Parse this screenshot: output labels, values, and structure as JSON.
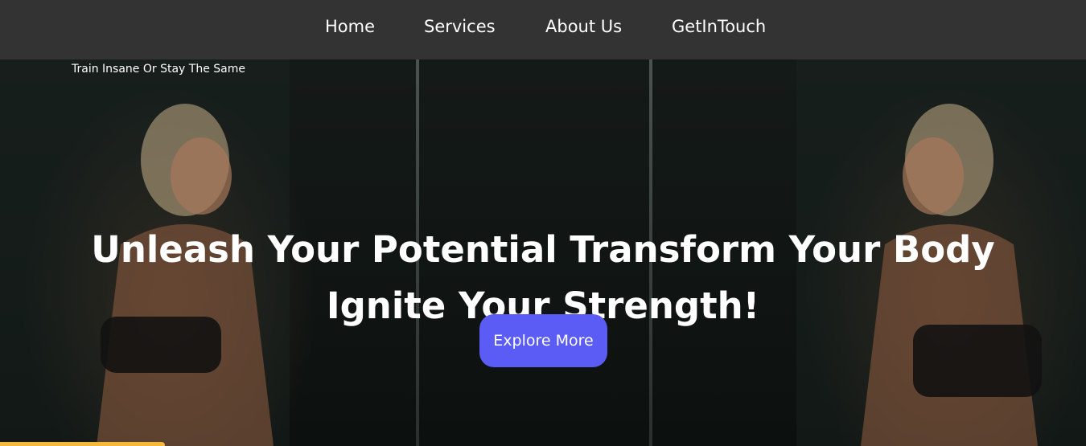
{
  "nav": {
    "items": [
      {
        "label": "Home"
      },
      {
        "label": "Services"
      },
      {
        "label": "About Us"
      },
      {
        "label": "GetInTouch"
      }
    ]
  },
  "hero": {
    "tagline": "Train Insane Or Stay The Same",
    "headline_line1": "Unleash Your Potential Transform Your Body",
    "headline_line2": "Ignite Your Strength!",
    "cta_label": "Explore More",
    "background_image": "two-athletes-mirror-gym-photo"
  },
  "colors": {
    "navbar": "#333333",
    "cta": "#5a5cf5",
    "accent": "#f4b93a",
    "text": "#ffffff"
  }
}
